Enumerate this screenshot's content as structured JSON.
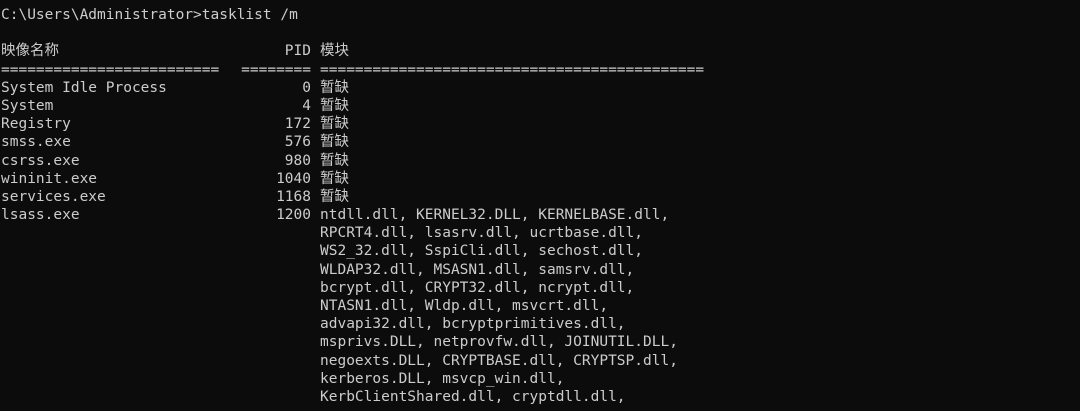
{
  "prompt": "C:\\Users\\Administrator>tasklist /m",
  "headers": {
    "name": "映像名称",
    "pid": "PID",
    "modules": "模块"
  },
  "separators": {
    "name": "=========================",
    "pid": "========",
    "modules": "============================================"
  },
  "rows": [
    {
      "name": "System Idle Process",
      "pid": "0",
      "modules": [
        "暂缺"
      ]
    },
    {
      "name": "System",
      "pid": "4",
      "modules": [
        "暂缺"
      ]
    },
    {
      "name": "Registry",
      "pid": "172",
      "modules": [
        "暂缺"
      ]
    },
    {
      "name": "smss.exe",
      "pid": "576",
      "modules": [
        "暂缺"
      ]
    },
    {
      "name": "csrss.exe",
      "pid": "980",
      "modules": [
        "暂缺"
      ]
    },
    {
      "name": "wininit.exe",
      "pid": "1040",
      "modules": [
        "暂缺"
      ]
    },
    {
      "name": "services.exe",
      "pid": "1168",
      "modules": [
        "暂缺"
      ]
    },
    {
      "name": "lsass.exe",
      "pid": "1200",
      "modules": [
        "ntdll.dll, KERNEL32.DLL, KERNELBASE.dll,",
        "RPCRT4.dll, lsasrv.dll, ucrtbase.dll,",
        "WS2_32.dll, SspiCli.dll, sechost.dll,",
        "WLDAP32.dll, MSASN1.dll, samsrv.dll,",
        "bcrypt.dll, CRYPT32.dll, ncrypt.dll,",
        "NTASN1.dll, Wldp.dll, msvcrt.dll,",
        "advapi32.dll, bcryptprimitives.dll,",
        "msprivs.DLL, netprovfw.dll, JOINUTIL.DLL,",
        "negoexts.DLL, CRYPTBASE.dll, CRYPTSP.dll,",
        "kerberos.DLL, msvcp_win.dll,",
        "KerbClientShared.dll, cryptdll.dll,"
      ]
    }
  ]
}
